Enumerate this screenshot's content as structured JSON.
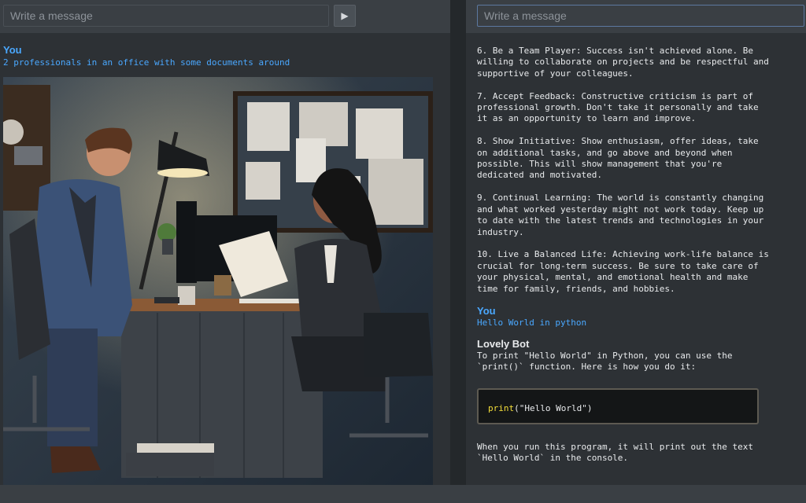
{
  "left": {
    "input_placeholder": "Write a message",
    "send_icon": "play-icon",
    "send_glyph": "▶",
    "user_sender": "You",
    "user_message": "2 professionals in an office with some documents around"
  },
  "right": {
    "input_placeholder": "Write a message",
    "bot_text_top": "6. Be a Team Player: Success isn't achieved alone. Be\nwilling to collaborate on projects and be respectful and\nsupportive of your colleagues.\n\n7. Accept Feedback: Constructive criticism is part of\nprofessional growth. Don't take it personally and take\nit as an opportunity to learn and improve.\n\n8. Show Initiative: Show enthusiasm, offer ideas, take\non additional tasks, and go above and beyond when\npossible. This will show management that you're\ndedicated and motivated.\n\n9. Continual Learning: The world is constantly changing\nand what worked yesterday might not work today. Keep up\nto date with the latest trends and technologies in your\nindustry.\n\n10. Live a Balanced Life: Achieving work-life balance is\ncrucial for long-term success. Be sure to take care of\nyour physical, mental, and emotional health and make\ntime for family, friends, and hobbies.",
    "user_sender": "You",
    "user_message": "Hello World in python",
    "bot_sender": "Lovely Bot",
    "bot_intro": "To print \"Hello World\" in Python, you can use the\n`print()` function. Here is how you do it:",
    "code_fn": "print",
    "code_args": "(\"Hello World\")",
    "bot_outro": "When you run this program, it will print out the text\n`Hello World` in the console."
  },
  "colors": {
    "user": "#4aa8ff",
    "code_keyword": "#f5df3a"
  }
}
